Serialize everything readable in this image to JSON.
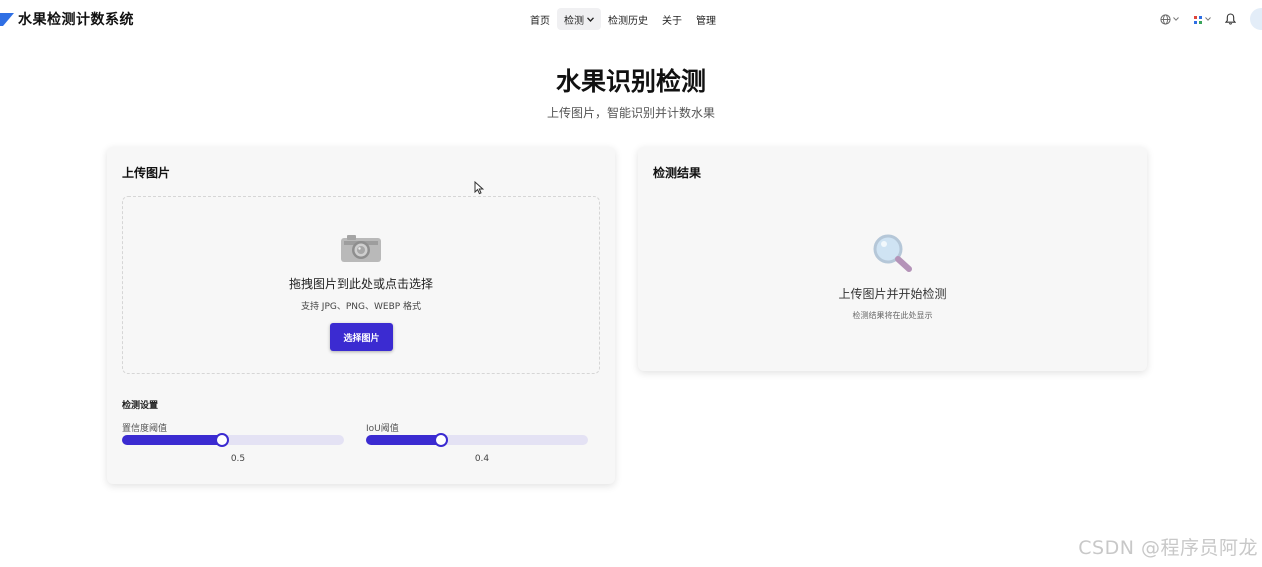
{
  "header": {
    "app_title": "水果检测计数系统",
    "logo_icon": "brand-logo-icon",
    "nav": [
      {
        "label": "首页"
      },
      {
        "label": "检测",
        "has_dropdown": true,
        "active": true
      },
      {
        "label": "检测历史"
      },
      {
        "label": "关于"
      },
      {
        "label": "管理"
      }
    ],
    "tools": {
      "language_icon": "globe-icon",
      "apps_icon": "grid-icon",
      "notification_icon": "bell-icon"
    }
  },
  "hero": {
    "title": "水果识别检测",
    "subtitle": "上传图片，智能识别并计数水果"
  },
  "upload_card": {
    "title": "上传图片",
    "dropzone": {
      "icon": "camera-icon",
      "title": "拖拽图片到此处或点击选择",
      "hint": "支持 JPG、PNG、WEBP 格式",
      "button_label": "选择图片"
    },
    "settings": {
      "title": "检测设置",
      "confidence": {
        "label": "置信度阈值",
        "value": "0.5",
        "fraction": 0.45
      },
      "iou": {
        "label": "IoU阈值",
        "value": "0.4",
        "fraction": 0.34
      }
    }
  },
  "result_card": {
    "title": "检测结果",
    "icon": "magnifier-icon",
    "empty_title": "上传图片并开始检测",
    "empty_hint": "检测结果将在此处显示"
  },
  "colors": {
    "accent": "#3b2bd1",
    "slider_track": "#e4e2f4",
    "card_bg": "#f7f7f7"
  },
  "watermark": "CSDN @程序员阿龙"
}
